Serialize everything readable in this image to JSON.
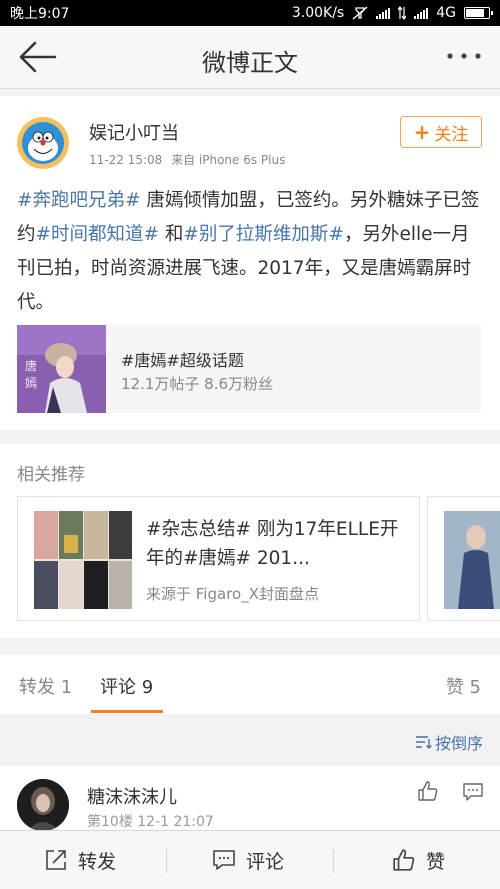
{
  "status_bar": {
    "time": "晚上9:07",
    "speed": "3.00K/s",
    "network": "4G"
  },
  "nav": {
    "title": "微博正文"
  },
  "post": {
    "author": "娱记小叮当",
    "time": "11-22 15:08",
    "source": "来自 iPhone 6s Plus",
    "follow_label": "关注",
    "text": {
      "tag1": "#奔跑吧兄弟#",
      "seg1": " 唐嫣倾情加盟，已签约。另外糖妹子已签约",
      "tag2": "#时间都知道#",
      "seg2": " 和",
      "tag3": "#别了拉斯维加斯#",
      "seg3": "，另外elle一月刊已拍，时尚资源进展飞速。2017年，又是唐嫣霸屏时代。"
    },
    "topic_card": {
      "title": "#唐嫣#超级话题",
      "stats": "12.1万帖子 8.6万粉丝"
    }
  },
  "related": {
    "section_title": "相关推荐",
    "card": {
      "text": "#杂志总结# 刚为17年ELLE开年的#唐嫣# 201...",
      "source": "来源于 Figaro_X封面盘点"
    }
  },
  "tabs": {
    "repost": "转发 1",
    "comments": "评论 9",
    "likes": "赞 5"
  },
  "sort": {
    "label": "按倒序"
  },
  "comment": {
    "name": "糖沫沫沫儿",
    "meta": "第10楼  12-1 21:07"
  },
  "bottom_bar": {
    "repost": "转发",
    "comment": "评论",
    "like": "赞"
  },
  "colors": {
    "accent": "#f08020",
    "link": "#4a76a8"
  }
}
